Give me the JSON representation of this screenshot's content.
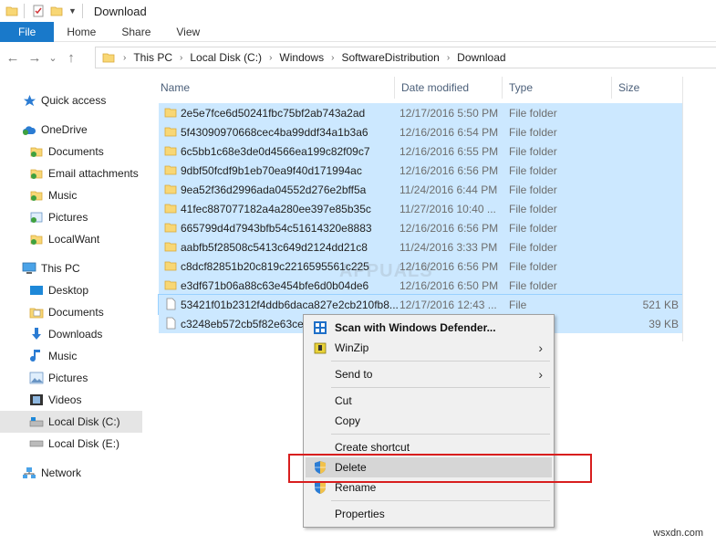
{
  "window": {
    "title": "Download"
  },
  "ribbon": {
    "tabs": [
      "File",
      "Home",
      "Share",
      "View"
    ]
  },
  "address": {
    "back": "←",
    "forward": "→",
    "recent": "⌄",
    "up": "↑",
    "crumbs": [
      "This PC",
      "Local Disk (C:)",
      "Windows",
      "SoftwareDistribution",
      "Download"
    ]
  },
  "sidebar": {
    "items": [
      "Quick access",
      "OneDrive",
      "Documents",
      "Email attachments",
      "Music",
      "Pictures",
      "LocalWant",
      "This PC",
      "Desktop",
      "Documents",
      "Downloads",
      "Music",
      "Pictures",
      "Videos",
      "Local Disk (C:)",
      "Local Disk (E:)",
      "Network"
    ]
  },
  "columns": {
    "name": "Name",
    "date": "Date modified",
    "type": "Type",
    "size": "Size"
  },
  "files": [
    {
      "name": "2e5e7fce6d50241fbc75bf2ab743a2ad",
      "date": "12/17/2016 5:50 PM",
      "type": "File folder",
      "size": ""
    },
    {
      "name": "5f43090970668cec4ba99ddf34a1b3a6",
      "date": "12/16/2016 6:54 PM",
      "type": "File folder",
      "size": ""
    },
    {
      "name": "6c5bb1c68e3de0d4566ea199c82f09c7",
      "date": "12/16/2016 6:55 PM",
      "type": "File folder",
      "size": ""
    },
    {
      "name": "9dbf50fcdf9b1eb70ea9f40d171994ac",
      "date": "12/16/2016 6:56 PM",
      "type": "File folder",
      "size": ""
    },
    {
      "name": "9ea52f36d2996ada04552d276e2bff5a",
      "date": "11/24/2016 6:44 PM",
      "type": "File folder",
      "size": ""
    },
    {
      "name": "41fec887077182a4a280ee397e85b35c",
      "date": "11/27/2016 10:40 ...",
      "type": "File folder",
      "size": ""
    },
    {
      "name": "665799d4d7943bfb54c51614320e8883",
      "date": "12/16/2016 6:56 PM",
      "type": "File folder",
      "size": ""
    },
    {
      "name": "aabfb5f28508c5413c649d2124dd21c8",
      "date": "11/24/2016 3:33 PM",
      "type": "File folder",
      "size": ""
    },
    {
      "name": "c8dcf82851b20c819c2216595561c225",
      "date": "12/16/2016 6:56 PM",
      "type": "File folder",
      "size": ""
    },
    {
      "name": "e3df671b06a88c63e454bfe6d0b04de6",
      "date": "12/16/2016 6:50 PM",
      "type": "File folder",
      "size": ""
    },
    {
      "name": "53421f01b2312f4ddb6daca827e2cb210fb8...",
      "date": "12/17/2016 12:43 ...",
      "type": "File",
      "size": "521 KB"
    },
    {
      "name": "c3248eb572cb5f82e63ce9",
      "date": "",
      "type": "",
      "size": "39 KB"
    }
  ],
  "context_menu": {
    "scan": "Scan with Windows Defender...",
    "winzip": "WinZip",
    "send_to": "Send to",
    "cut": "Cut",
    "copy": "Copy",
    "create_shortcut": "Create shortcut",
    "delete": "Delete",
    "rename": "Rename",
    "properties": "Properties",
    "arrow": "›"
  },
  "watermarks": {
    "site": "wsxdn.com",
    "appuals": "APPUALS"
  },
  "colors": {
    "accent": "#1979ca",
    "selection": "#cce8ff",
    "highlight_box": "#d81e1e",
    "folder": "#f8d775"
  }
}
